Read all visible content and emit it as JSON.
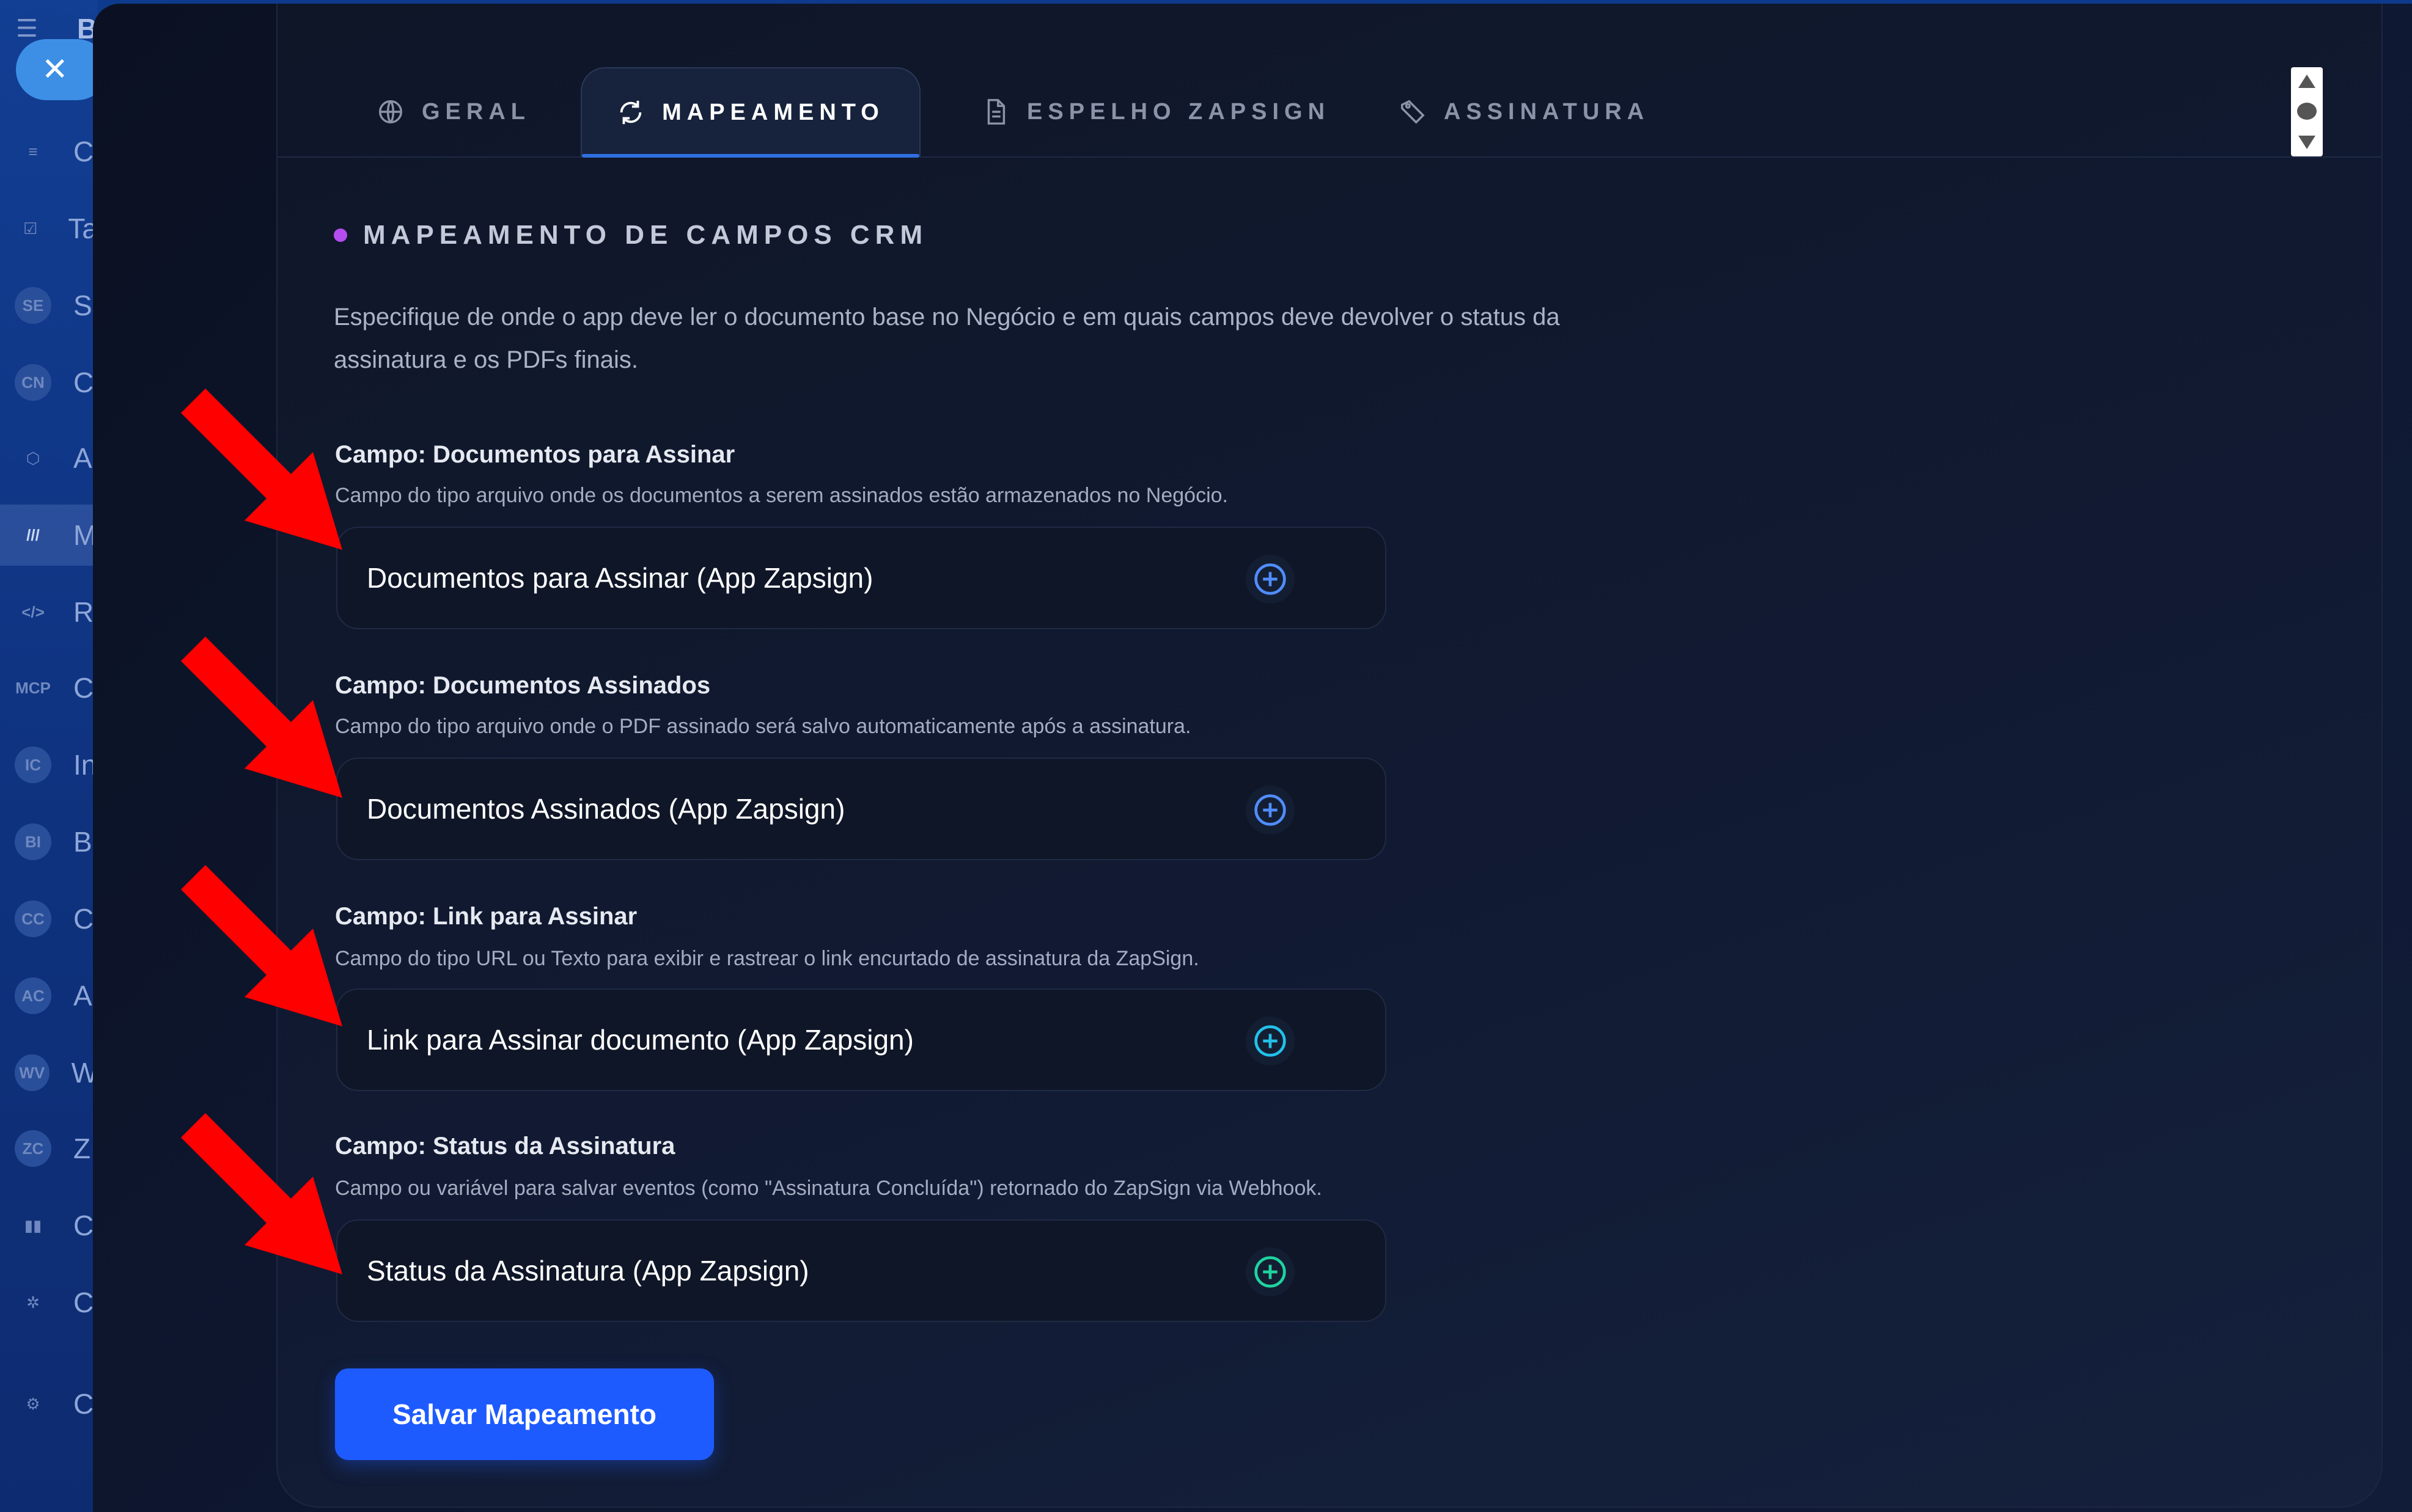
{
  "sidebar": {
    "top_letter": "B",
    "items": [
      {
        "icon": "filter-icon",
        "glyph": "≡",
        "letter": "C"
      },
      {
        "icon": "checkbox-icon",
        "glyph": "☑",
        "letter": "Ta"
      },
      {
        "icon": "badge-se",
        "glyph": "SE",
        "letter": "S"
      },
      {
        "icon": "badge-cn",
        "glyph": "CN",
        "letter": "C"
      },
      {
        "icon": "cube-icon",
        "glyph": "⬡",
        "letter": "A"
      },
      {
        "icon": "brand-icon",
        "glyph": "///",
        "letter": "M"
      },
      {
        "icon": "code-icon",
        "glyph": "</>",
        "letter": "R"
      },
      {
        "icon": "badge-mcp",
        "glyph": "MCP",
        "letter": "C"
      },
      {
        "icon": "badge-ic",
        "glyph": "IC",
        "letter": "In"
      },
      {
        "icon": "badge-bi",
        "glyph": "BI",
        "letter": "B"
      },
      {
        "icon": "badge-cc",
        "glyph": "CC",
        "letter": "C"
      },
      {
        "icon": "badge-ac",
        "glyph": "AC",
        "letter": "A"
      },
      {
        "icon": "badge-wv",
        "glyph": "WV",
        "letter": "W"
      },
      {
        "icon": "badge-zc",
        "glyph": "ZC",
        "letter": "Z"
      },
      {
        "icon": "chart-icon",
        "glyph": "▮▮",
        "letter": "C"
      },
      {
        "icon": "puzzle-icon",
        "glyph": "✲",
        "letter": "C"
      },
      {
        "icon": "settings-icon",
        "glyph": "⚙",
        "letter": "C"
      }
    ]
  },
  "tabs": [
    {
      "label": "GERAL",
      "icon": "globe-icon"
    },
    {
      "label": "MAPEAMENTO",
      "icon": "refresh-icon",
      "active": true
    },
    {
      "label": "ESPELHO ZAPSIGN",
      "icon": "document-icon"
    },
    {
      "label": "ASSINATURA",
      "icon": "pen-tag-icon"
    }
  ],
  "section": {
    "title": "MAPEAMENTO DE CAMPOS CRM",
    "intro_line1": "Especifique de onde o app deve ler o documento base no Negócio e em quais campos deve devolver o status da",
    "intro_line2": "assinatura e os PDFs finais."
  },
  "fields": [
    {
      "label": "Campo: Documentos para Assinar",
      "description": "Campo do tipo arquivo onde os documentos a serem assinados estão armazenados no Negócio.",
      "value": "Documentos para Assinar (App Zapsign)",
      "add_color": "#4f8dff"
    },
    {
      "label": "Campo: Documentos Assinados",
      "description": "Campo do tipo arquivo onde o PDF assinado será salvo automaticamente após a assinatura.",
      "value": "Documentos Assinados (App Zapsign)",
      "add_color": "#4f8dff"
    },
    {
      "label": "Campo: Link para Assinar",
      "description": "Campo do tipo URL ou Texto para exibir e rastrear o link encurtado de assinatura da ZapSign.",
      "value": "Link para Assinar documento (App Zapsign)",
      "add_color": "#22c1e8"
    },
    {
      "label": "Campo: Status da Assinatura",
      "description": "Campo ou variável para salvar eventos (como \"Assinatura Concluída\") retornado do ZapSign via Webhook.",
      "value": "Status da Assinatura (App Zapsign)",
      "add_color": "#1fd3a0"
    }
  ],
  "actions": {
    "save_label": "Salvar Mapeamento"
  },
  "colors": {
    "accent": "#1e5bff",
    "dot": "#b44cf0",
    "annotation_arrow": "#ff0000"
  }
}
